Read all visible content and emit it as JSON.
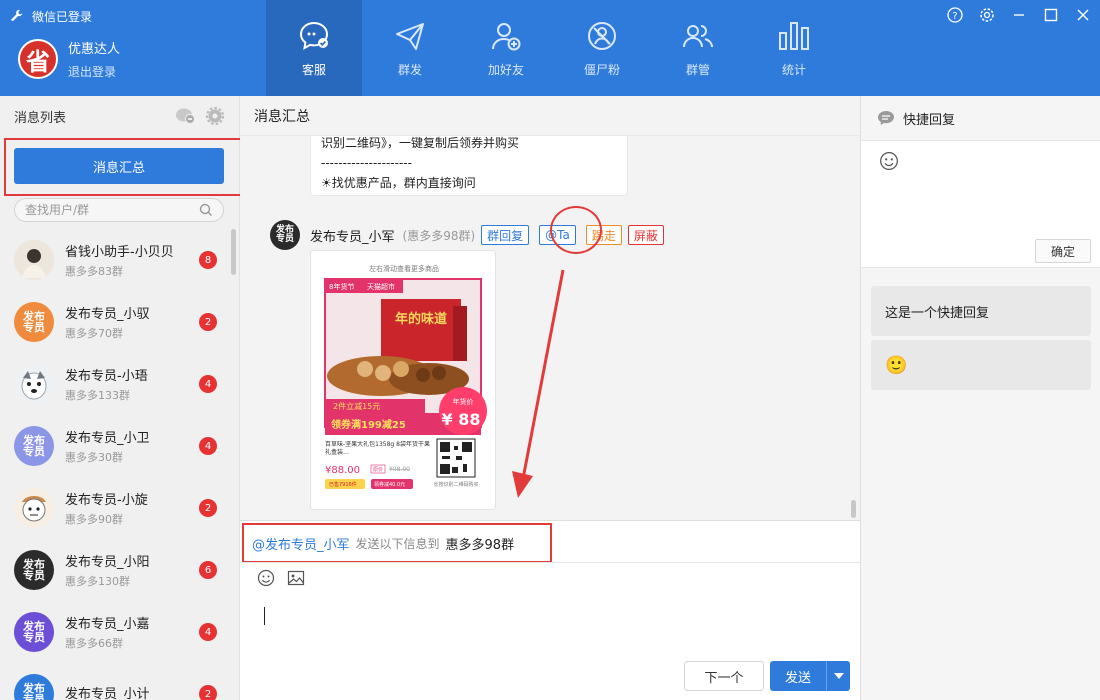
{
  "window": {
    "title": "微信已登录"
  },
  "user": {
    "avatar_char": "省",
    "name": "优惠达人",
    "logout": "退出登录"
  },
  "nav": [
    {
      "label": "客服",
      "icon": "chat-gear-icon",
      "active": true
    },
    {
      "label": "群发",
      "icon": "paper-plane-icon",
      "active": false
    },
    {
      "label": "加好友",
      "icon": "add-user-icon",
      "active": false
    },
    {
      "label": "僵尸粉",
      "icon": "zombie-fan-icon",
      "active": false
    },
    {
      "label": "群管",
      "icon": "group-users-icon",
      "active": false
    },
    {
      "label": "统计",
      "icon": "bar-stats-icon",
      "active": false
    }
  ],
  "sidebar": {
    "title": "消息列表",
    "summary_button": "消息汇总",
    "search_placeholder": "查找用户/群",
    "contacts": [
      {
        "name": "省钱小助手-小贝贝",
        "group": "惠多多83群",
        "badge": "8",
        "avatar_text": "",
        "avatar_color": "#d9d3c8"
      },
      {
        "name": "发布专员_小驭",
        "group": "惠多多70群",
        "badge": "2",
        "avatar_text": "发布\n专员",
        "avatar_color": "#f08a3c"
      },
      {
        "name": "发布专员-小珸",
        "group": "惠多多133群",
        "badge": "4",
        "avatar_text": "",
        "avatar_color": "#b7c2cc"
      },
      {
        "name": "发布专员_小卫",
        "group": "惠多多30群",
        "badge": "4",
        "avatar_text": "发布\n专员",
        "avatar_color": "#8c96e6"
      },
      {
        "name": "发布专员-小旋",
        "group": "惠多多90群",
        "badge": "2",
        "avatar_text": "",
        "avatar_color": "#e8d4bf"
      },
      {
        "name": "发布专员_小阳",
        "group": "惠多多130群",
        "badge": "6",
        "avatar_text": "发布\n专员",
        "avatar_color": "#2b2b2b"
      },
      {
        "name": "发布专员_小嘉",
        "group": "惠多多66群",
        "badge": "4",
        "avatar_text": "发布\n专员",
        "avatar_color": "#6c4fd6"
      },
      {
        "name": "发布专员_小计",
        "group": "",
        "badge": "2",
        "avatar_text": "发布",
        "avatar_color": "#2f7bdc"
      }
    ]
  },
  "main": {
    "title": "消息汇总",
    "prev_message": {
      "line1": "识别二维码》，一键复制后领券并购买",
      "line2": "---------------------",
      "line3": "☀找优惠产品，群内直接询问"
    },
    "message": {
      "sender": "发布专员_小军",
      "group": "(惠多多98群)",
      "avatar_text": "发布\n专员",
      "tags": [
        {
          "label": "群回复",
          "style": "blue"
        },
        {
          "label": "@Ta",
          "style": "blue"
        },
        {
          "label": "踢走",
          "style": "orange"
        },
        {
          "label": "屏蔽",
          "style": "red"
        }
      ],
      "image": {
        "hint": "左右滑动查看更多商品",
        "banner_left": "8年货节",
        "banner_right": "天猫超市",
        "box_text": "年的味道",
        "promo": "2件立减15元",
        "tag": "年货价",
        "coupon": "领券满199减25",
        "price_big": "¥ 88",
        "desc": "百草味-坚果大礼包1358g 8袋年货干果礼盒装…",
        "price": "¥88.00",
        "orig_label": "原价",
        "orig_price": "¥98.00",
        "sold": "已售7916件",
        "coupon_small": "领券减40.0元",
        "qr_hint": "长按识别二维码购买"
      }
    },
    "send_to": {
      "at_user": "@发布专员_小军",
      "middle": "发送以下信息到",
      "group": "惠多多98群"
    },
    "buttons": {
      "next": "下一个",
      "send": "发送"
    }
  },
  "right": {
    "title": "快捷回复",
    "confirm": "确定",
    "items": [
      "这是一个快捷回复",
      "🙂"
    ]
  },
  "colors": {
    "primary": "#2f7bdc",
    "highlight_red": "#e23b3b",
    "badge_red": "#e63232"
  }
}
